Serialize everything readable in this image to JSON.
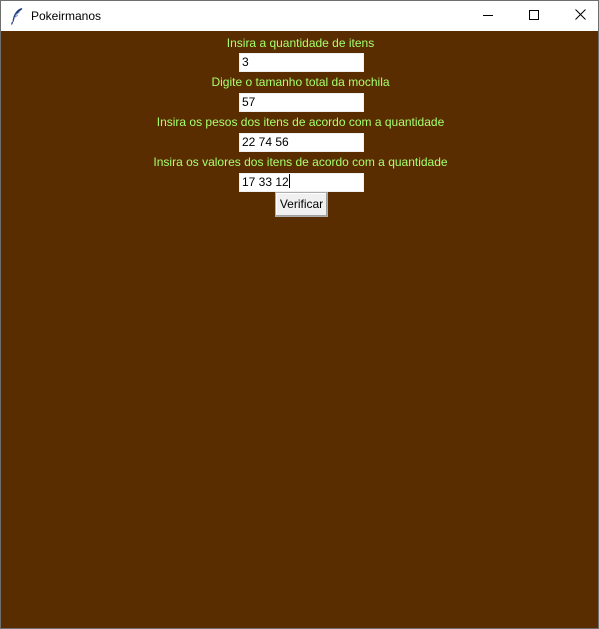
{
  "window": {
    "title": "Pokeirmanos",
    "icon": "feather-icon",
    "controls": [
      "minimize-icon",
      "maximize-icon",
      "close-icon"
    ]
  },
  "form": {
    "quantity_label": "Insira a quantidade de itens",
    "quantity_value": "3",
    "capacity_label": "Digite o tamanho total da mochila",
    "capacity_value": "57",
    "weights_label": "Insira os pesos dos itens de acordo com a quantidade",
    "weights_value": "22 74 56",
    "values_label": "Insira os valores dos itens de acordo com a quantidade",
    "values_value": "17 33 12",
    "submit_label": "Verificar"
  },
  "colors": {
    "background": "#5a2d00",
    "label_text": "#a6ff6e",
    "entry_background": "#ffffff",
    "button_background": "#f0f0f0"
  }
}
